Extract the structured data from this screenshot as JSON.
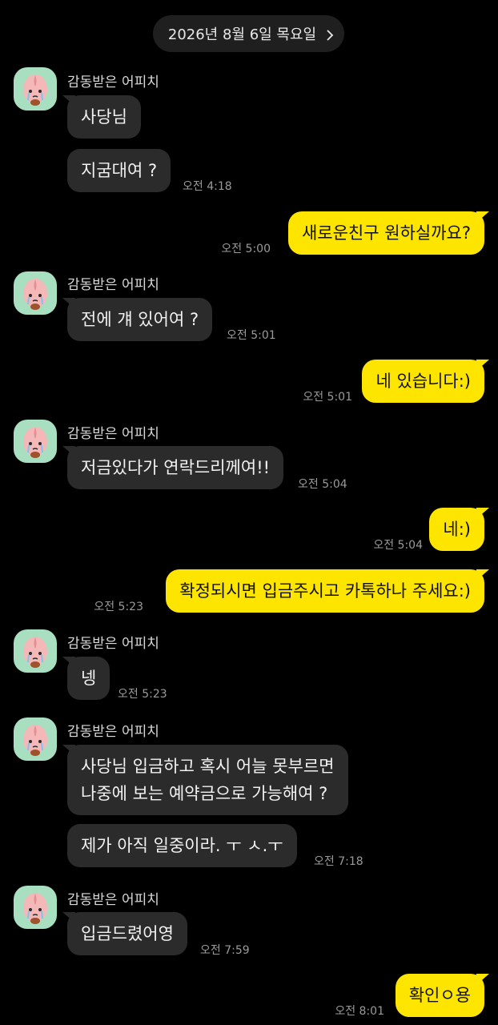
{
  "date_header": {
    "label": "2026년 8월 6일 목요일"
  },
  "sender_name": "감동받은 어피치",
  "messages": [
    {
      "text": "사당님"
    },
    {
      "text": "지굼대여 ?",
      "time": "오전 4:18"
    },
    {
      "text": "새로운친구 원하실까요?",
      "time": "오전 5:00"
    },
    {
      "text": "전에 걔 있어여 ?",
      "time": "오전 5:01"
    },
    {
      "text": "네 있습니다:)",
      "time": "오전 5:01"
    },
    {
      "text": "저금있다가 연락드리께여!!",
      "time": "오전 5:04"
    },
    {
      "text": "네:)",
      "time": "오전 5:04"
    },
    {
      "text": "확정되시면 입금주시고 카톡하나 주세요:)",
      "time": "오전 5:23"
    },
    {
      "text": "넹",
      "time": "오전 5:23"
    },
    {
      "line1": "사당님 입금하고 혹시 어늘 못부르면",
      "line2": "나중에 보는 예약금으로 가능해여 ?"
    },
    {
      "text": "제가 아직 일중이라. ㅜ ㅅ.ㅜ",
      "time": "오전 7:18"
    },
    {
      "text": "입금드렸어영",
      "time": "오전 7:59"
    },
    {
      "text": "확인ㅇ용",
      "time": "오전 8:01"
    }
  ],
  "colors": {
    "background": "#000000",
    "incoming_bubble": "#2b2b2b",
    "outgoing_bubble": "#fee500",
    "avatar_bg": "#a9dfc1"
  },
  "icons": {
    "avatar": "apeach-character-icon",
    "date_chevron": "chevron-right-icon"
  }
}
